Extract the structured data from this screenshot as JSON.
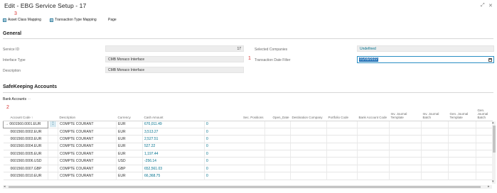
{
  "window": {
    "title": "Edit - EBG Service Setup - 17",
    "maximize_glyph": "⤢",
    "close_glyph": "✕"
  },
  "markers": {
    "m1": "1",
    "m2": "2",
    "m3": "3"
  },
  "actions": [
    {
      "label": "Asset Class Mapping",
      "icon": "table-icon"
    },
    {
      "label": "Transaction Type Mapping",
      "icon": "table-icon"
    },
    {
      "label": "Page"
    }
  ],
  "general": {
    "section_title": "General",
    "service_id": {
      "label": "Service ID",
      "value": "17"
    },
    "interface_type": {
      "label": "Interface Type",
      "value": "CMB Monaco Interface"
    },
    "description": {
      "label": "Description",
      "value": "CMB Monaco Interface"
    },
    "selected_companies": {
      "label": "Selected Companies",
      "value": "Undefined"
    },
    "transaction_date_filter": {
      "label": "Transaction Date Filter",
      "value": "01/09/2022"
    }
  },
  "safekeeping": {
    "section_title": "SafeKeeping Accounts",
    "subheader": "Bank Accounts",
    "sub_suffix": "···",
    "columns": [
      "Account Code ↑",
      "",
      "Description",
      "Currency",
      "Cash Amount",
      "Sec. Positions",
      "Open_Date",
      "Destination Company",
      "Portfolio Code",
      "Bank Account Code",
      "Inv. Journal Template",
      "Inv. Journal Batch",
      "Gen. Journal Template",
      "Gen. Journal Batch"
    ],
    "rows": [
      {
        "code": "0601560.0001.EUR",
        "desc": "COMPTE COURANT",
        "cur": "EUR",
        "amount": "670,011.49",
        "sec": "0",
        "selected": true
      },
      {
        "code": "0601560.0002.EUR",
        "desc": "COMPTE COURANT",
        "cur": "EUR",
        "amount": "3,513.27",
        "sec": "0"
      },
      {
        "code": "0601560.0003.EUR",
        "desc": "COMPTE COURANT",
        "cur": "EUR",
        "amount": "2,527.51",
        "sec": "0"
      },
      {
        "code": "0601560.0004.EUR",
        "desc": "COMPTE COURANT",
        "cur": "EUR",
        "amount": "527.22",
        "sec": "0"
      },
      {
        "code": "0601560.0005.EUR",
        "desc": "COMPTE COURANT",
        "cur": "EUR",
        "amount": "1,197.44",
        "sec": "0"
      },
      {
        "code": "0601560.0006.USD",
        "desc": "COMPTE COURANT",
        "cur": "USD",
        "amount": "-256.14",
        "sec": "0"
      },
      {
        "code": "0601560.0007.GBP",
        "desc": "COMPTE COURANT",
        "cur": "GBP",
        "amount": "652,561.03",
        "sec": "0"
      },
      {
        "code": "0601560.0010.EUR",
        "desc": "COMPTE COURANT",
        "cur": "EUR",
        "amount": "66,368.75",
        "sec": "0"
      }
    ]
  },
  "colors": {
    "accent": "#00708c",
    "marker": "#d8312f",
    "focus": "#2b8fc4",
    "selection": "#1f6fb5"
  }
}
